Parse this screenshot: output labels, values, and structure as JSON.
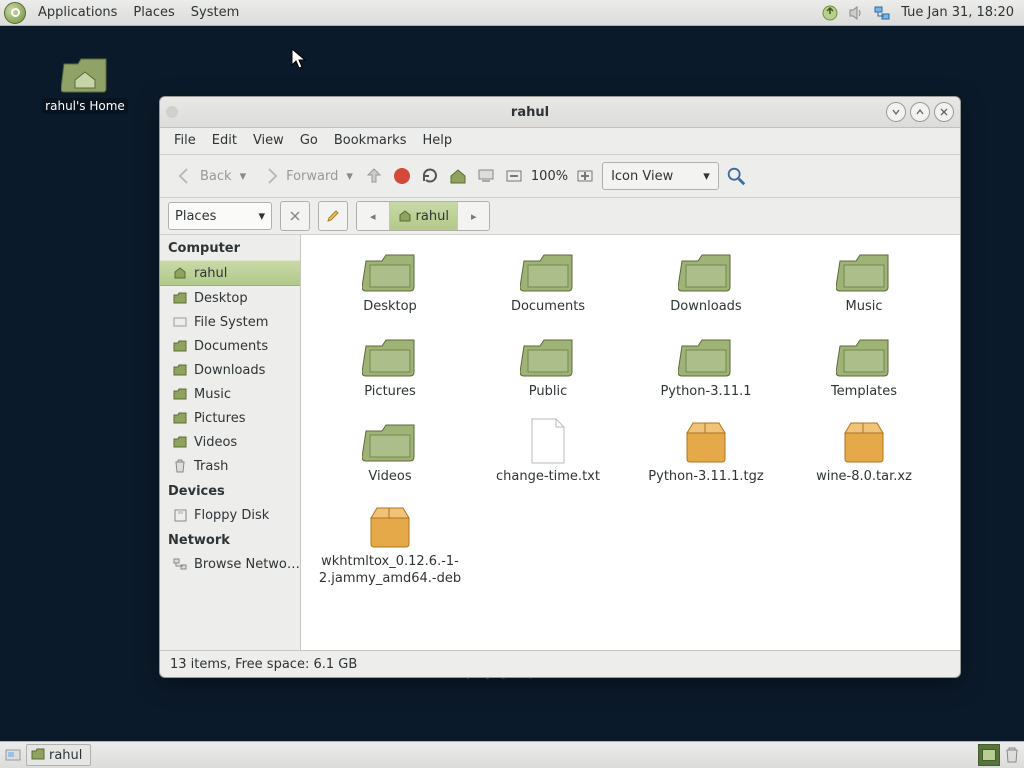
{
  "panel": {
    "apps_label": "Applications",
    "places_label": "Places",
    "system_label": "System",
    "clock": "Tue Jan 31, 18:20"
  },
  "desktop": {
    "home_icon_label": "rahul's Home",
    "distro": "debian"
  },
  "taskbar": {
    "task_label": "rahul"
  },
  "window": {
    "title": "rahul",
    "menubar": {
      "file": "File",
      "edit": "Edit",
      "view": "View",
      "go": "Go",
      "bookmarks": "Bookmarks",
      "help": "Help"
    },
    "toolbar": {
      "back": "Back",
      "forward": "Forward",
      "zoom": "100%",
      "view_mode": "Icon View"
    },
    "location": {
      "places_label": "Places",
      "current_folder": "rahul"
    },
    "sidebar": {
      "computer_heading": "Computer",
      "devices_heading": "Devices",
      "network_heading": "Network",
      "rows": {
        "rahul": "rahul",
        "desktop": "Desktop",
        "filesystem": "File System",
        "documents": "Documents",
        "downloads": "Downloads",
        "music": "Music",
        "pictures": "Pictures",
        "videos": "Videos",
        "trash": "Trash",
        "floppy": "Floppy Disk",
        "browse_network": "Browse Netwo…"
      }
    },
    "items": [
      {
        "name": "Desktop",
        "type": "folder"
      },
      {
        "name": "Documents",
        "type": "folder"
      },
      {
        "name": "Downloads",
        "type": "folder"
      },
      {
        "name": "Music",
        "type": "folder"
      },
      {
        "name": "Pictures",
        "type": "folder"
      },
      {
        "name": "Public",
        "type": "folder"
      },
      {
        "name": "Python-3.11.1",
        "type": "folder"
      },
      {
        "name": "Templates",
        "type": "folder"
      },
      {
        "name": "Videos",
        "type": "folder"
      },
      {
        "name": "change-time.txt",
        "type": "text"
      },
      {
        "name": "Python-3.11.1.tgz",
        "type": "archive"
      },
      {
        "name": "wine-8.0.tar.xz",
        "type": "archive"
      },
      {
        "name": "wkhtmltox_0.12.6.-1-2.jammy_amd64.-deb",
        "type": "archive"
      }
    ],
    "status": "13 items, Free space: 6.1 GB"
  }
}
